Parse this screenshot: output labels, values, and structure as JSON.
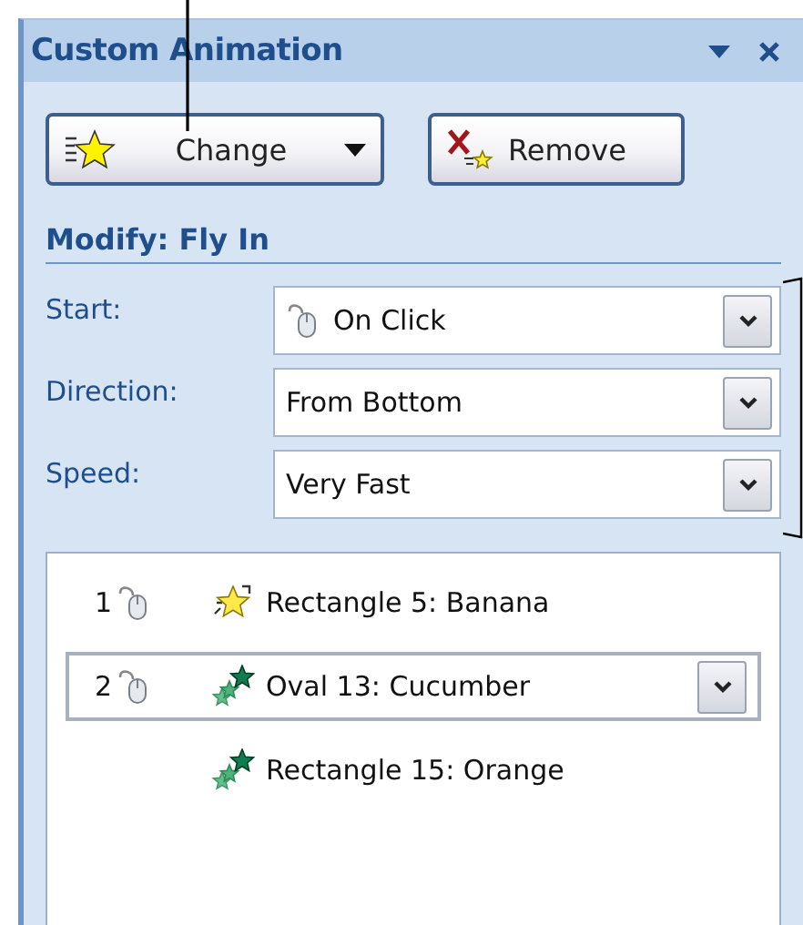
{
  "panel": {
    "title": "Custom Animation"
  },
  "buttons": [
    {
      "kind": "change",
      "label": "Change"
    },
    {
      "kind": "remove",
      "label": "Remove"
    }
  ],
  "modify": {
    "heading": "Modify: Fly In"
  },
  "settings": [
    {
      "label": "Start:",
      "value": "On Click",
      "on_click": true
    },
    {
      "label": "Direction:",
      "value": "From Bottom",
      "on_click": false
    },
    {
      "label": "Speed:",
      "value": "Very Fast",
      "on_click": false
    }
  ],
  "animations": [
    {
      "order": "1",
      "on_click": true,
      "kind": "emphasis",
      "name": "Rectangle 5: Banana",
      "selected": false
    },
    {
      "order": "2",
      "on_click": true,
      "kind": "entrance",
      "name": "Oval 13: Cucumber",
      "selected": true
    },
    {
      "on_click": false,
      "kind": "entrance",
      "name": "Rectangle 15: Orange",
      "selected": false
    }
  ]
}
